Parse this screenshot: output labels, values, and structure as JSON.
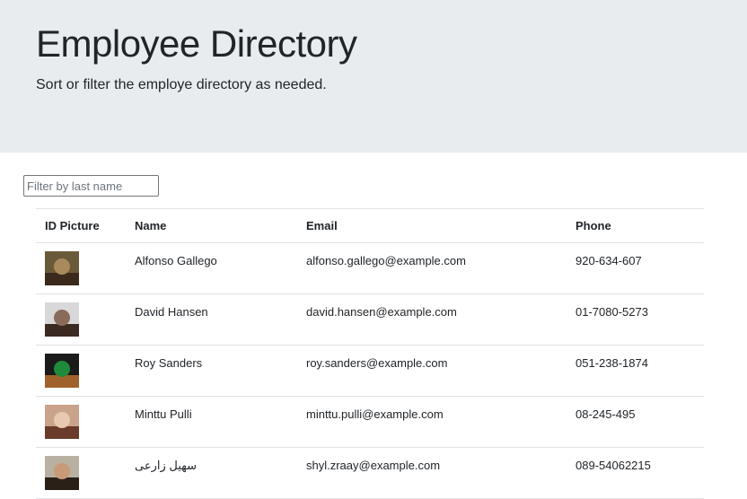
{
  "header": {
    "title": "Employee Directory",
    "subtitle": "Sort or filter the employe directory as needed."
  },
  "filter": {
    "placeholder": "Filter by last name",
    "value": ""
  },
  "table": {
    "columns": [
      "ID Picture",
      "Name",
      "Email",
      "Phone"
    ],
    "rows": [
      {
        "name": "Alfonso Gallego",
        "email": "alfonso.gallego@example.com",
        "phone": "920-634-607",
        "avatar_colors": [
          "#6b5a3a",
          "#3b2a1c",
          "#a88a5c"
        ]
      },
      {
        "name": "David Hansen",
        "email": "david.hansen@example.com",
        "phone": "01-7080-5273",
        "avatar_colors": [
          "#d8d8d8",
          "#3a2a22",
          "#8a6a5a"
        ]
      },
      {
        "name": "Roy Sanders",
        "email": "roy.sanders@example.com",
        "phone": "051-238-1874",
        "avatar_colors": [
          "#1a1a1a",
          "#a0622c",
          "#1f8a3a"
        ]
      },
      {
        "name": "Minttu Pulli",
        "email": "minttu.pulli@example.com",
        "phone": "08-245-495",
        "avatar_colors": [
          "#c9a38a",
          "#6a3a2a",
          "#e8c8b0"
        ]
      },
      {
        "name": "سهیل زارعی",
        "email": "shyl.zraay@example.com",
        "phone": "089-54062215",
        "avatar_colors": [
          "#b8b0a0",
          "#2a2018",
          "#c89a78"
        ]
      }
    ]
  }
}
